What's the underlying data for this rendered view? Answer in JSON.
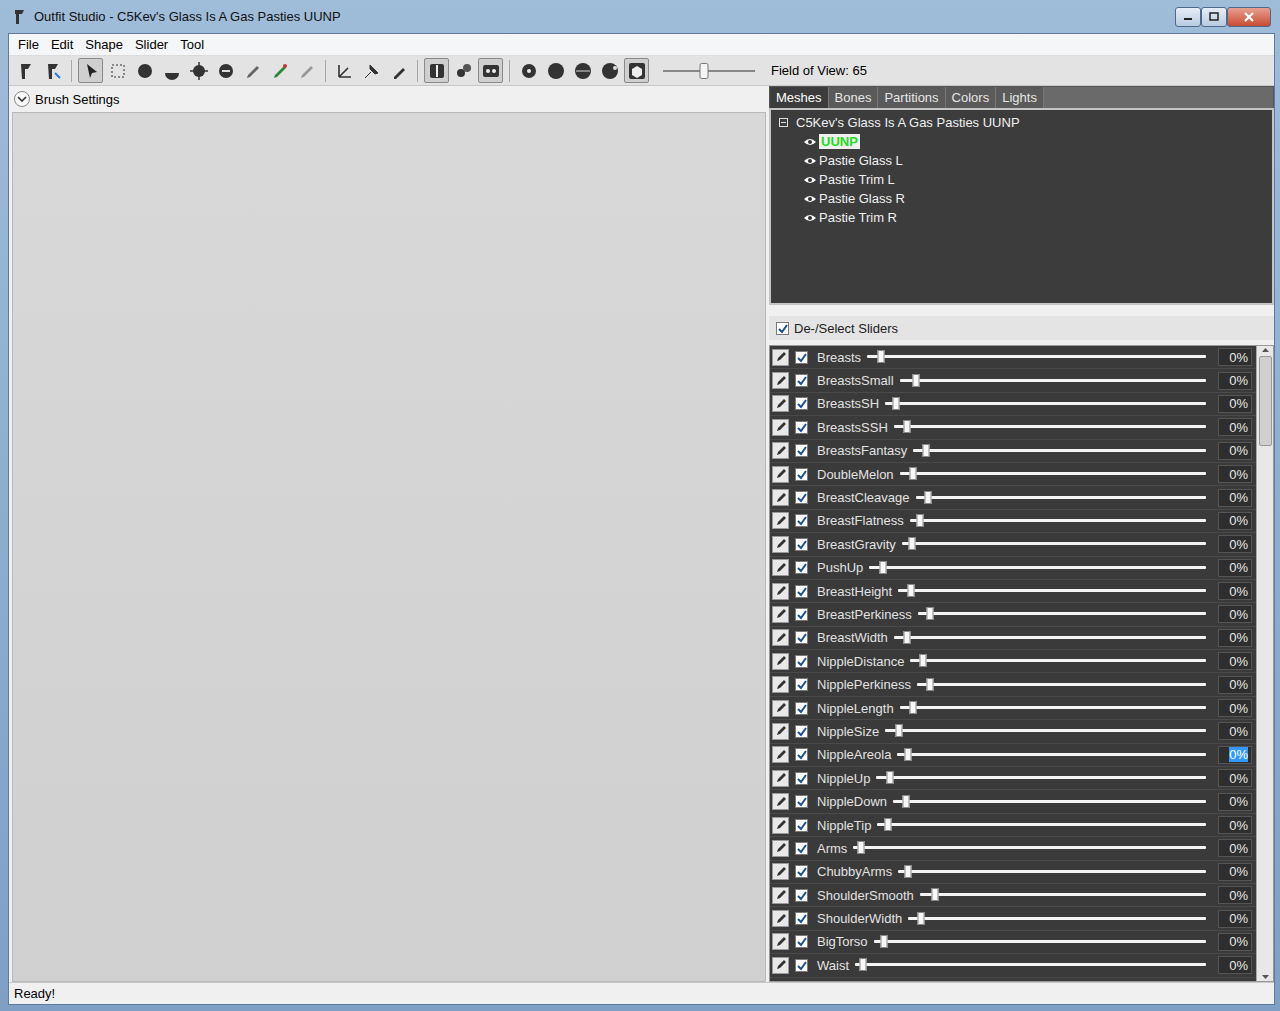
{
  "window": {
    "title": "Outfit Studio - C5Kev's Glass Is A Gas Pasties UUNP"
  },
  "menu": [
    "File",
    "Edit",
    "Shape",
    "Slider",
    "Tool"
  ],
  "toolbar": {
    "buttons": [
      {
        "selected": false
      },
      {
        "selected": false
      },
      {
        "selected": true
      },
      {
        "selected": false
      },
      {
        "selected": false
      },
      {
        "selected": false
      },
      {
        "selected": false
      },
      {
        "selected": false
      },
      {
        "selected": false
      },
      {
        "selected": false
      },
      {
        "selected": false
      },
      {
        "selected": false
      },
      {
        "selected": false
      },
      {
        "selected": false
      },
      {
        "selected": true
      },
      {
        "selected": false
      },
      {
        "selected": true
      },
      {
        "selected": false
      },
      {
        "selected": false
      },
      {
        "selected": false
      },
      {
        "selected": false
      },
      {
        "selected": true
      }
    ],
    "fov": {
      "label": "Field of View: 65",
      "level": 0.45
    }
  },
  "brush_settings": {
    "label": "Brush Settings",
    "expanded": true
  },
  "tabs": [
    {
      "label": "Meshes",
      "selected": true
    },
    {
      "label": "Bones",
      "selected": false
    },
    {
      "label": "Partitions",
      "selected": false
    },
    {
      "label": "Colors",
      "selected": false
    },
    {
      "label": "Lights",
      "selected": false
    }
  ],
  "mesh_tree": {
    "root": {
      "label": "C5Kev's Glass Is A Gas Pasties UUNP",
      "expanded": true
    },
    "items": [
      {
        "label": "UUNP",
        "visible": true,
        "selected": true
      },
      {
        "label": "Pastie Glass L",
        "visible": true,
        "selected": false
      },
      {
        "label": "Pastie Trim L",
        "visible": true,
        "selected": false
      },
      {
        "label": "Pastie Glass R",
        "visible": true,
        "selected": false
      },
      {
        "label": "Pastie Trim R",
        "visible": true,
        "selected": false
      }
    ]
  },
  "sliders_header": {
    "label": "De-/Select Sliders",
    "checked": true
  },
  "sliders": [
    {
      "name": "Breasts",
      "checked": true,
      "level": 0.03,
      "reading": "0%",
      "selected": false
    },
    {
      "name": "BreastsSmall",
      "checked": true,
      "level": 0.04,
      "reading": "0%",
      "selected": false
    },
    {
      "name": "BreastsSH",
      "checked": true,
      "level": 0.02,
      "reading": "0%",
      "selected": false
    },
    {
      "name": "BreastsSSH",
      "checked": true,
      "level": 0.03,
      "reading": "0%",
      "selected": false
    },
    {
      "name": "BreastsFantasy",
      "checked": true,
      "level": 0.03,
      "reading": "0%",
      "selected": false
    },
    {
      "name": "DoubleMelon",
      "checked": true,
      "level": 0.03,
      "reading": "0%",
      "selected": false
    },
    {
      "name": "BreastCleavage",
      "checked": true,
      "level": 0.03,
      "reading": "0%",
      "selected": false
    },
    {
      "name": "BreastFlatness",
      "checked": true,
      "level": 0.02,
      "reading": "0%",
      "selected": false
    },
    {
      "name": "BreastGravity",
      "checked": true,
      "level": 0.02,
      "reading": "0%",
      "selected": false
    },
    {
      "name": "PushUp",
      "checked": true,
      "level": 0.03,
      "reading": "0%",
      "selected": false
    },
    {
      "name": "BreastHeight",
      "checked": true,
      "level": 0.03,
      "reading": "0%",
      "selected": false
    },
    {
      "name": "BreastPerkiness",
      "checked": true,
      "level": 0.03,
      "reading": "0%",
      "selected": false
    },
    {
      "name": "BreastWidth",
      "checked": true,
      "level": 0.03,
      "reading": "0%",
      "selected": false
    },
    {
      "name": "NippleDistance",
      "checked": true,
      "level": 0.03,
      "reading": "0%",
      "selected": false
    },
    {
      "name": "NipplePerkiness",
      "checked": true,
      "level": 0.03,
      "reading": "0%",
      "selected": false
    },
    {
      "name": "NippleLength",
      "checked": true,
      "level": 0.03,
      "reading": "0%",
      "selected": false
    },
    {
      "name": "NippleSize",
      "checked": true,
      "level": 0.03,
      "reading": "0%",
      "selected": false
    },
    {
      "name": "NippleAreola",
      "checked": true,
      "level": 0.02,
      "reading": "0%",
      "selected": true
    },
    {
      "name": "NippleUp",
      "checked": true,
      "level": 0.03,
      "reading": "0%",
      "selected": false
    },
    {
      "name": "NippleDown",
      "checked": true,
      "level": 0.03,
      "reading": "0%",
      "selected": false
    },
    {
      "name": "NippleTip",
      "checked": true,
      "level": 0.02,
      "reading": "0%",
      "selected": false
    },
    {
      "name": "Arms",
      "checked": true,
      "level": 0.01,
      "reading": "0%",
      "selected": false
    },
    {
      "name": "ChubbyArms",
      "checked": true,
      "level": 0.02,
      "reading": "0%",
      "selected": false
    },
    {
      "name": "ShoulderSmooth",
      "checked": true,
      "level": 0.04,
      "reading": "0%",
      "selected": false
    },
    {
      "name": "ShoulderWidth",
      "checked": true,
      "level": 0.03,
      "reading": "0%",
      "selected": false
    },
    {
      "name": "BigTorso",
      "checked": true,
      "level": 0.02,
      "reading": "0%",
      "selected": false
    },
    {
      "name": "Waist",
      "checked": true,
      "level": 0.01,
      "reading": "0%",
      "selected": false
    }
  ],
  "status_bar": "Ready!"
}
